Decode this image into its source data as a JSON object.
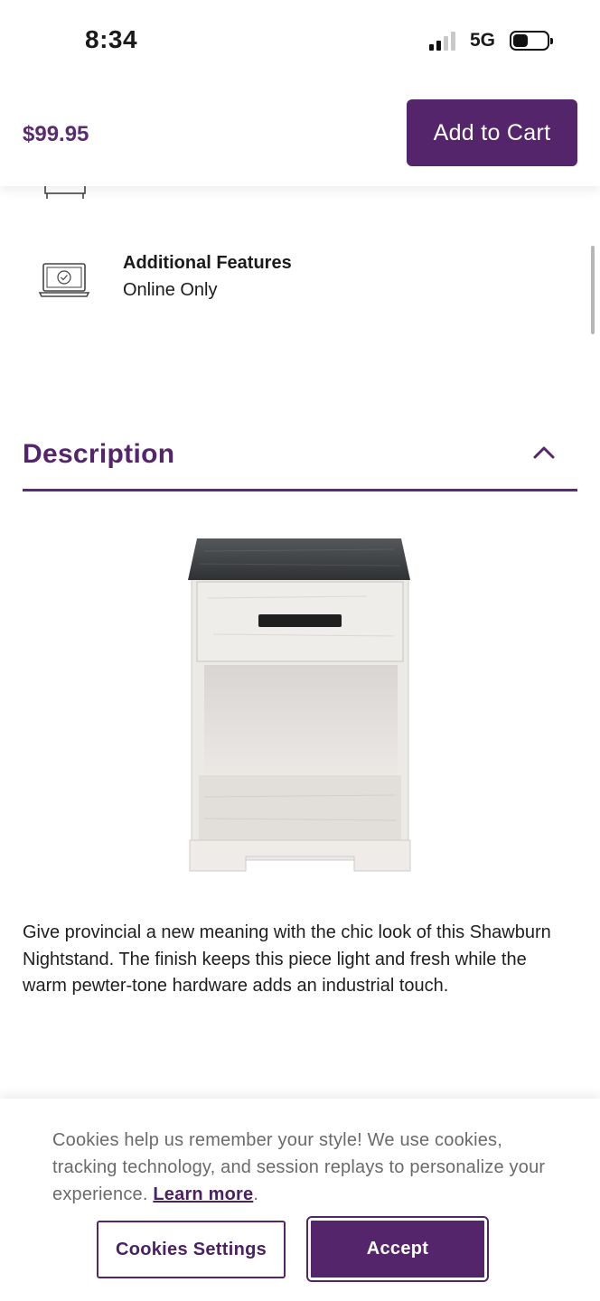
{
  "status_bar": {
    "time": "8:34",
    "network": "5G",
    "signal_bars_active": 2,
    "signal_bars_total": 4,
    "battery_level": 0.45
  },
  "sticky_bar": {
    "price": "$99.95",
    "add_to_cart_label": "Add to Cart"
  },
  "features": [
    {
      "icon": "laptop-check-icon",
      "title": "Additional Features",
      "value": "Online Only"
    }
  ],
  "description": {
    "heading": "Description",
    "expanded": true,
    "text": "Give provincial a new meaning with the chic look of this Shawburn Nightstand. The finish keeps this piece light and fresh while the warm pewter-tone hardware adds an industrial touch."
  },
  "cookie_banner": {
    "message": "Cookies help us remember your style! We use cookies, tracking technology, and session replays to personalize your experience.",
    "link_label": "Learn more",
    "link_suffix": ".",
    "settings_label": "Cookies Settings",
    "accept_label": "Accept"
  },
  "colors": {
    "brand_purple": "#55256b",
    "price_purple": "#5b2a74"
  }
}
